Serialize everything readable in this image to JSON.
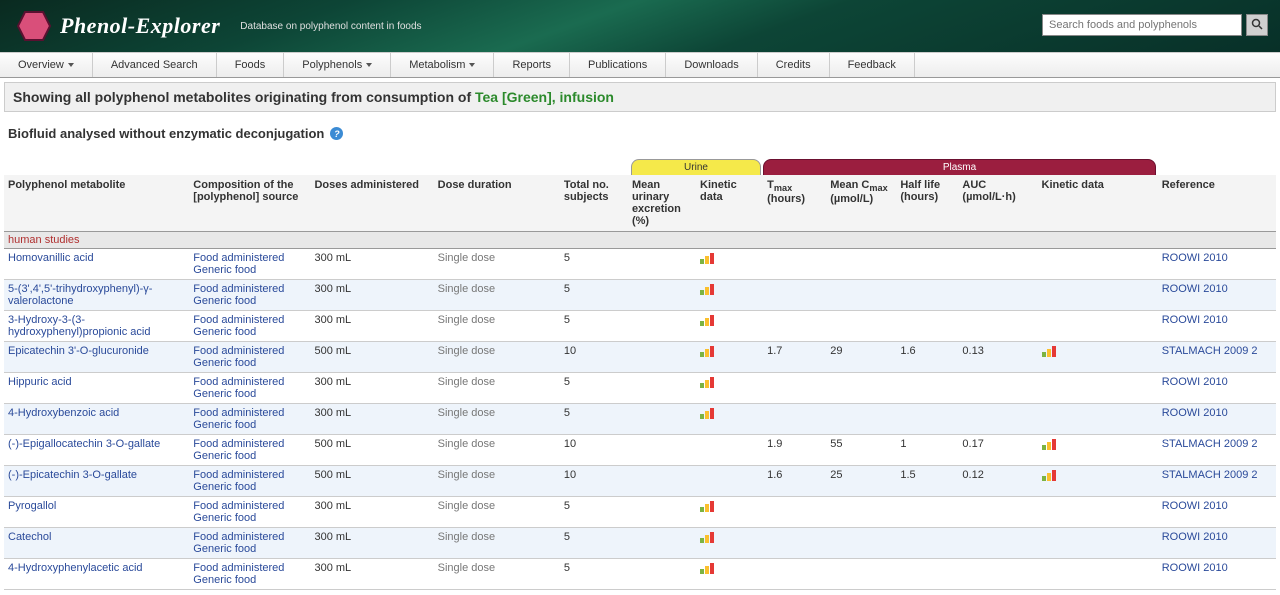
{
  "header": {
    "logo_text": "Phenol-Explorer",
    "subtitle": "Database on polyphenol content in foods",
    "search_placeholder": "Search foods and polyphenols"
  },
  "menu": [
    "Overview",
    "Advanced Search",
    "Foods",
    "Polyphenols",
    "Metabolism",
    "Reports",
    "Publications",
    "Downloads",
    "Credits",
    "Feedback"
  ],
  "menu_has_caret": [
    true,
    false,
    false,
    true,
    true,
    false,
    false,
    false,
    false,
    false
  ],
  "title_prefix": "Showing all polyphenol metabolites originating from consumption of ",
  "title_food": "Tea [Green], infusion",
  "biofluid_title": "Biofluid analysed without enzymatic deconjugation",
  "bands": {
    "urine": "Urine",
    "plasma": "Plasma"
  },
  "columns": {
    "metabolite": "Polyphenol metabolite",
    "composition": "Composition of the [polyphenol] source",
    "doses": "Doses administered",
    "duration": "Dose duration",
    "subjects": "Total no. subjects",
    "urinary": "Mean urinary excretion (%)",
    "kinetic_u": "Kinetic data",
    "tmax": "Tmax (hours)",
    "cmax": "Mean Cmax (µmol/L)",
    "half": "Half life (hours)",
    "auc": "AUC (µmol/L·h)",
    "kinetic_p": "Kinetic data",
    "reference": "Reference"
  },
  "section_label": "human studies",
  "rows": [
    {
      "met": "Homovanillic acid",
      "comp": "Food administered Generic food",
      "dose": "300 mL",
      "dur": "Single dose",
      "sub": "5",
      "ur": "",
      "kd_u": true,
      "tmax": "",
      "cmax": "",
      "half": "",
      "auc": "",
      "kd_p": false,
      "ref": "ROOWI 2010"
    },
    {
      "met": "5-(3',4',5'-trihydroxyphenyl)-γ-valerolactone",
      "comp": "Food administered Generic food",
      "dose": "300 mL",
      "dur": "Single dose",
      "sub": "5",
      "ur": "",
      "kd_u": true,
      "tmax": "",
      "cmax": "",
      "half": "",
      "auc": "",
      "kd_p": false,
      "ref": "ROOWI 2010"
    },
    {
      "met": "3-Hydroxy-3-(3-hydroxyphenyl)propionic acid",
      "comp": "Food administered Generic food",
      "dose": "300 mL",
      "dur": "Single dose",
      "sub": "5",
      "ur": "",
      "kd_u": true,
      "tmax": "",
      "cmax": "",
      "half": "",
      "auc": "",
      "kd_p": false,
      "ref": "ROOWI 2010"
    },
    {
      "met": "Epicatechin 3'-O-glucuronide",
      "comp": "Food administered Generic food",
      "dose": "500 mL",
      "dur": "Single dose",
      "sub": "10",
      "ur": "",
      "kd_u": true,
      "tmax": "1.7",
      "cmax": "29",
      "half": "1.6",
      "auc": "0.13",
      "kd_p": true,
      "ref": "STALMACH 2009 2"
    },
    {
      "met": "Hippuric acid",
      "comp": "Food administered Generic food",
      "dose": "300 mL",
      "dur": "Single dose",
      "sub": "5",
      "ur": "",
      "kd_u": true,
      "tmax": "",
      "cmax": "",
      "half": "",
      "auc": "",
      "kd_p": false,
      "ref": "ROOWI 2010"
    },
    {
      "met": "4-Hydroxybenzoic acid",
      "comp": "Food administered Generic food",
      "dose": "300 mL",
      "dur": "Single dose",
      "sub": "5",
      "ur": "",
      "kd_u": true,
      "tmax": "",
      "cmax": "",
      "half": "",
      "auc": "",
      "kd_p": false,
      "ref": "ROOWI 2010"
    },
    {
      "met": "(-)-Epigallocatechin 3-O-gallate",
      "comp": "Food administered Generic food",
      "dose": "500 mL",
      "dur": "Single dose",
      "sub": "10",
      "ur": "",
      "kd_u": false,
      "tmax": "1.9",
      "cmax": "55",
      "half": "1",
      "auc": "0.17",
      "kd_p": true,
      "ref": "STALMACH 2009 2"
    },
    {
      "met": "(-)-Epicatechin 3-O-gallate",
      "comp": "Food administered Generic food",
      "dose": "500 mL",
      "dur": "Single dose",
      "sub": "10",
      "ur": "",
      "kd_u": false,
      "tmax": "1.6",
      "cmax": "25",
      "half": "1.5",
      "auc": "0.12",
      "kd_p": true,
      "ref": "STALMACH 2009 2"
    },
    {
      "met": "Pyrogallol",
      "comp": "Food administered Generic food",
      "dose": "300 mL",
      "dur": "Single dose",
      "sub": "5",
      "ur": "",
      "kd_u": true,
      "tmax": "",
      "cmax": "",
      "half": "",
      "auc": "",
      "kd_p": false,
      "ref": "ROOWI 2010"
    },
    {
      "met": "Catechol",
      "comp": "Food administered Generic food",
      "dose": "300 mL",
      "dur": "Single dose",
      "sub": "5",
      "ur": "",
      "kd_u": true,
      "tmax": "",
      "cmax": "",
      "half": "",
      "auc": "",
      "kd_p": false,
      "ref": "ROOWI 2010"
    },
    {
      "met": "4-Hydroxyphenylacetic acid",
      "comp": "Food administered Generic food",
      "dose": "300 mL",
      "dur": "Single dose",
      "sub": "5",
      "ur": "",
      "kd_u": true,
      "tmax": "",
      "cmax": "",
      "half": "",
      "auc": "",
      "kd_p": false,
      "ref": "ROOWI 2010"
    }
  ]
}
